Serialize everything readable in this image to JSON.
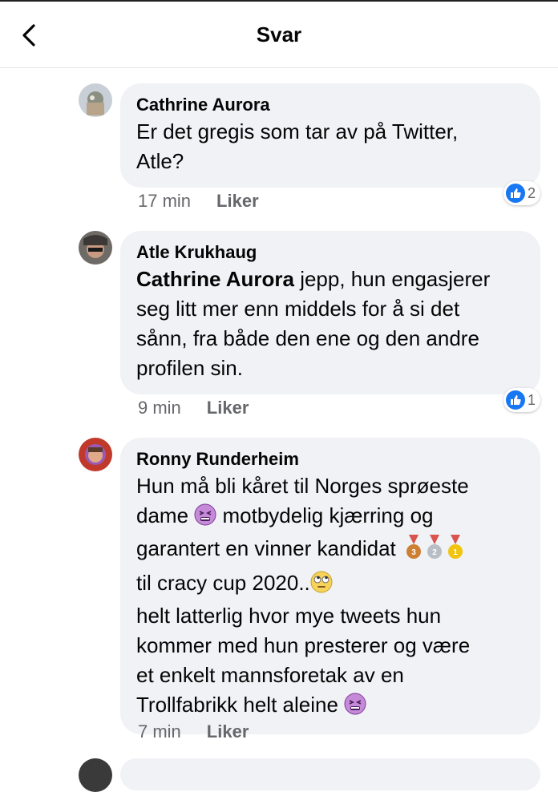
{
  "header": {
    "title": "Svar"
  },
  "comments": [
    {
      "author": "Cathrine Aurora",
      "text_lines": [
        "Er det gregis som tar av på Twitter,",
        "Atle?"
      ],
      "time": "17 min",
      "like_label": "Liker",
      "reaction_count": "2"
    },
    {
      "author": "Atle Krukhaug",
      "mention": "Cathrine Aurora",
      "text_first": " jepp, hun engasjerer",
      "text_lines": [
        "seg litt mer enn middels for å si det",
        "sånn, fra både den ene og den andre",
        "profilen sin."
      ],
      "time": "9 min",
      "like_label": "Liker",
      "reaction_count": "1"
    },
    {
      "author": "Ronny Runderheim",
      "line1": "Hun må bli kåret til Norges sprøeste",
      "line2a": "dame ",
      "line2b": " motbydelig kjærring og",
      "line3": "garantert en vinner kandidat ",
      "line4": "til cracy cup 2020..",
      "line5": "helt latterlig hvor mye tweets hun",
      "line6": "kommer med hun presterer og være",
      "line7": "et enkelt mannsforetak av en",
      "line8": "Trollfabrikk helt aleine ",
      "time": "7 min",
      "like_label": "Liker"
    }
  ],
  "icons": {
    "back": "chevron-left-icon",
    "reaction": "thumbs-up-icon",
    "emoji_tired": "tired-face-emoji-icon",
    "emoji_eyeroll": "eye-roll-emoji-icon",
    "medals": [
      "bronze-medal-icon",
      "silver-medal-icon",
      "gold-medal-icon"
    ]
  },
  "colors": {
    "like_blue": "#1877f2",
    "bubble": "#f0f2f5",
    "meta": "#65676b"
  }
}
